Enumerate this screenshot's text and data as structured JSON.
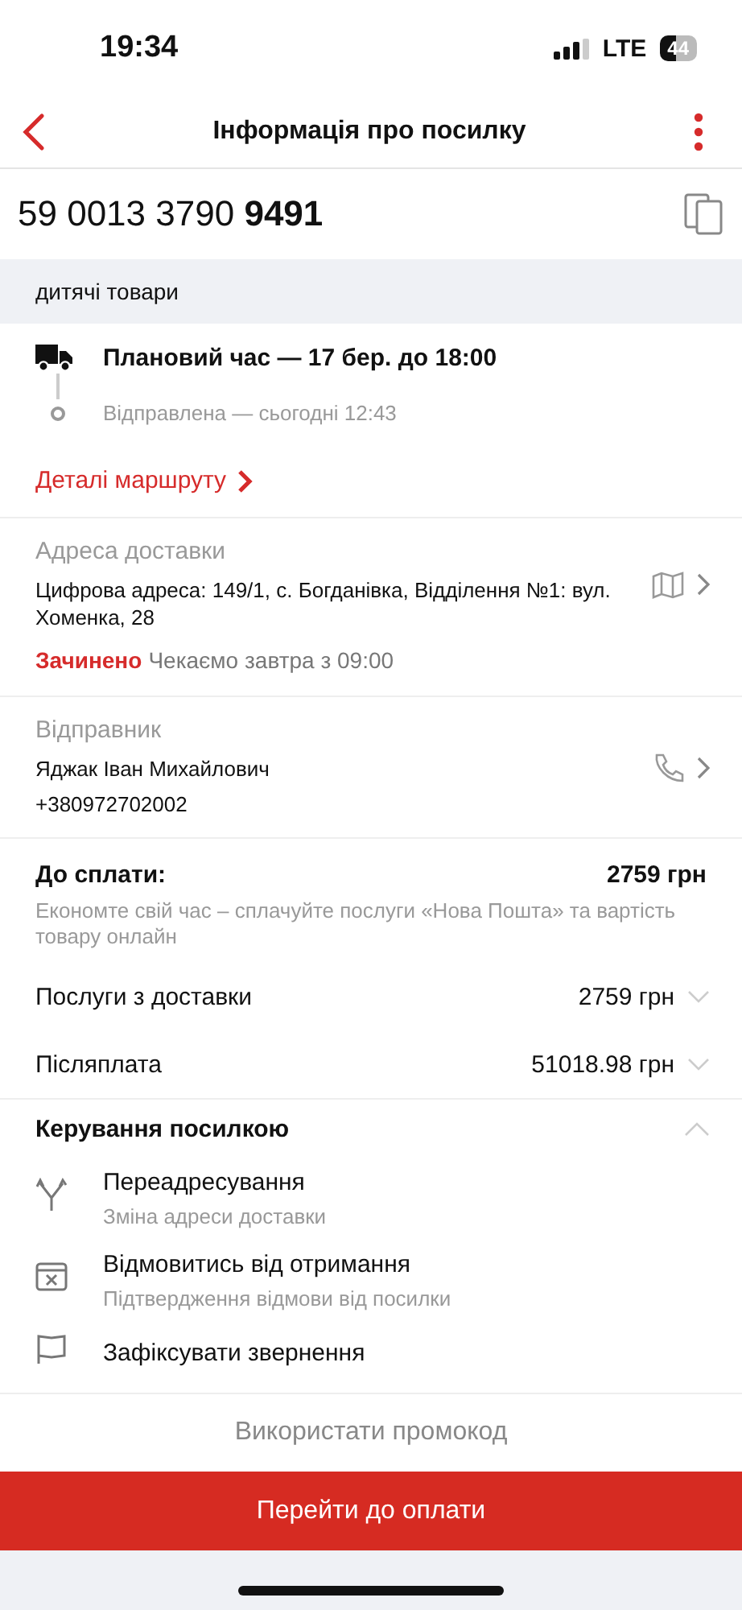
{
  "status_bar": {
    "time": "19:34",
    "network": "LTE",
    "battery": "44"
  },
  "header": {
    "title": "Інформація про посилку"
  },
  "tracking": {
    "number": "59 0013 3790 **9491**"
  },
  "category": "дитячі товари",
  "timeline": [
    {
      "kind": "truck",
      "text": "Плановий час — 17 бер. до 18:00"
    },
    {
      "kind": "dot",
      "text": "Відправлена — сьогодні 12:43"
    }
  ],
  "route_link": "Деталі маршруту",
  "address": {
    "label": "Адреса доставки",
    "value": "Цифрова адреса: 149/1, с. Богданівка, Відділення №1: вул. Хоменка, 28",
    "status": "Зачинено",
    "status_note": "Чекаємо завтра з 09:00"
  },
  "sender": {
    "label": "Відправник",
    "name": "Яджак Іван Михайлович",
    "phone": "+380972702002"
  },
  "payment": {
    "title": "До сплати:",
    "amount": "2759 грн",
    "note": "Економте свій час – сплачуйте послуги «Нова Пошта» та вартість товару онлайн"
  },
  "payment_lines": [
    {
      "label": "Послуги з доставки",
      "amount": "2759 грн",
      "expanded": false
    },
    {
      "label": "Післяплата",
      "amount": "51018.98 грн",
      "expanded": false
    }
  ],
  "management": {
    "title": "Керування посилкою",
    "expanded": true,
    "items": [
      {
        "kind": "redirect",
        "title": "Переадресування",
        "subtitle": "Зміна адреси доставки"
      },
      {
        "kind": "refuse",
        "title": "Відмовитись від отримання",
        "subtitle": "Підтвердження відмови від посилки"
      },
      {
        "kind": "flag",
        "title": "Зафіксувати звернення"
      }
    ]
  },
  "promo_button": "Використати промокод",
  "pay_button": "Перейти до оплати"
}
